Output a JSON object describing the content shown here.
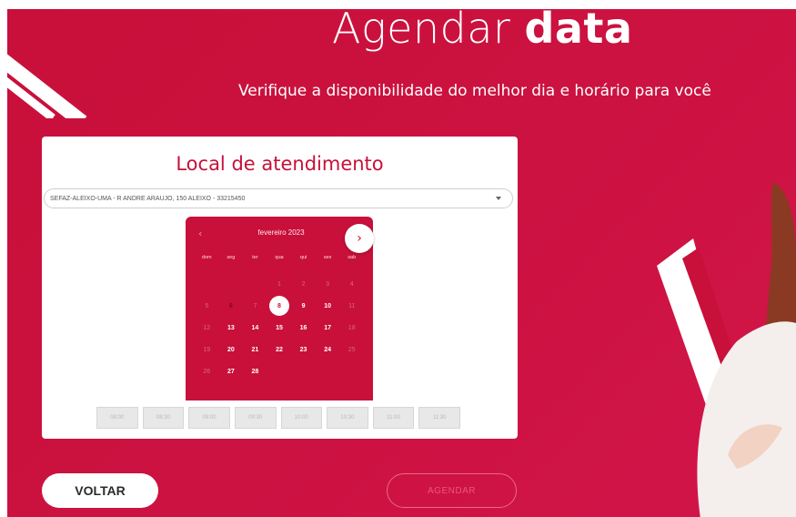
{
  "hero": {
    "title_light": "Agendar",
    "title_bold": "data",
    "subtitle": "Verifique a disponibilidade do melhor dia e horário para você"
  },
  "card": {
    "title": "Local de atendimento",
    "location_select": {
      "value": "SEFAZ-ALEIXO-UMA - R ANDRE ARAUJO, 150 ALEIXO - 33215450"
    }
  },
  "calendar": {
    "month_label": "fevereiro 2023",
    "prev_icon": "‹",
    "next_icon": "›",
    "weekdays": [
      "dom",
      "seg",
      "ter",
      "qua",
      "qui",
      "sex",
      "sab"
    ],
    "days": [
      {
        "label": "",
        "state": "empty"
      },
      {
        "label": "",
        "state": "empty"
      },
      {
        "label": "",
        "state": "empty"
      },
      {
        "label": "1",
        "state": "muted"
      },
      {
        "label": "2",
        "state": "muted"
      },
      {
        "label": "3",
        "state": "muted"
      },
      {
        "label": "4",
        "state": "muted"
      },
      {
        "label": "5",
        "state": "muted"
      },
      {
        "label": "6",
        "state": "dark"
      },
      {
        "label": "7",
        "state": "muted"
      },
      {
        "label": "8",
        "state": "selected"
      },
      {
        "label": "9",
        "state": "active"
      },
      {
        "label": "10",
        "state": "active"
      },
      {
        "label": "11",
        "state": "muted"
      },
      {
        "label": "12",
        "state": "muted"
      },
      {
        "label": "13",
        "state": "active"
      },
      {
        "label": "14",
        "state": "active"
      },
      {
        "label": "15",
        "state": "active"
      },
      {
        "label": "16",
        "state": "active"
      },
      {
        "label": "17",
        "state": "active"
      },
      {
        "label": "18",
        "state": "muted"
      },
      {
        "label": "19",
        "state": "muted"
      },
      {
        "label": "20",
        "state": "active"
      },
      {
        "label": "21",
        "state": "active"
      },
      {
        "label": "22",
        "state": "active"
      },
      {
        "label": "23",
        "state": "active"
      },
      {
        "label": "24",
        "state": "active"
      },
      {
        "label": "25",
        "state": "muted"
      },
      {
        "label": "26",
        "state": "muted"
      },
      {
        "label": "27",
        "state": "active"
      },
      {
        "label": "28",
        "state": "active"
      }
    ]
  },
  "time_slots": [
    "08:00",
    "08:30",
    "09:00",
    "09:30",
    "10:00",
    "10:30",
    "11:00",
    "11:30"
  ],
  "buttons": {
    "back": "VOLTAR",
    "schedule": "AGENDAR"
  },
  "colors": {
    "brand_red": "#c8103a",
    "white": "#ffffff",
    "slot_disabled": "#e8e8e8"
  }
}
